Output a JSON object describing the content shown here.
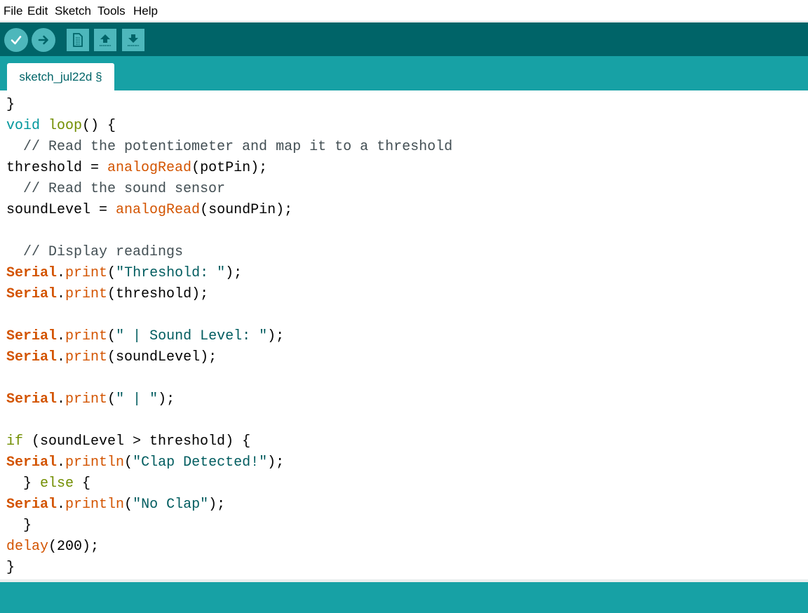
{
  "menu": [
    "File",
    "Edit",
    "Sketch",
    "Tools",
    "Help"
  ],
  "toolbar": {
    "buttons": [
      "verify-icon",
      "upload-icon",
      "new-icon",
      "open-icon",
      "save-icon"
    ]
  },
  "tab": {
    "label": "sketch_jul22d §"
  },
  "colors": {
    "default": "#000000",
    "keyword": "#00979c",
    "function": "#d35400",
    "class": "#d35400",
    "comment": "#434f54",
    "string": "#005c5f",
    "control": "#728e00",
    "toolbar": "#006468",
    "accent": "#17a1a5"
  },
  "code": [
    [
      [
        "}",
        "default"
      ]
    ],
    [
      [
        "void",
        "keyword"
      ],
      [
        " ",
        "default"
      ],
      [
        "loop",
        "control"
      ],
      [
        "() {",
        "default"
      ]
    ],
    [
      [
        "  // Read the potentiometer and map it to a threshold",
        "comment"
      ]
    ],
    [
      [
        "threshold = ",
        "default"
      ],
      [
        "analogRead",
        "function"
      ],
      [
        "(potPin);",
        "default"
      ]
    ],
    [
      [
        "  // Read the sound sensor",
        "comment"
      ]
    ],
    [
      [
        "soundLevel = ",
        "default"
      ],
      [
        "analogRead",
        "function"
      ],
      [
        "(soundPin);",
        "default"
      ]
    ],
    [],
    [
      [
        "  // Display readings",
        "comment"
      ]
    ],
    [
      [
        "Serial",
        "class"
      ],
      [
        ".",
        "default"
      ],
      [
        "print",
        "function"
      ],
      [
        "(",
        "default"
      ],
      [
        "\"Threshold: \"",
        "string"
      ],
      [
        ");",
        "default"
      ]
    ],
    [
      [
        "Serial",
        "class"
      ],
      [
        ".",
        "default"
      ],
      [
        "print",
        "function"
      ],
      [
        "(threshold);",
        "default"
      ]
    ],
    [],
    [
      [
        "Serial",
        "class"
      ],
      [
        ".",
        "default"
      ],
      [
        "print",
        "function"
      ],
      [
        "(",
        "default"
      ],
      [
        "\" | Sound Level: \"",
        "string"
      ],
      [
        ");",
        "default"
      ]
    ],
    [
      [
        "Serial",
        "class"
      ],
      [
        ".",
        "default"
      ],
      [
        "print",
        "function"
      ],
      [
        "(soundLevel);",
        "default"
      ]
    ],
    [],
    [
      [
        "Serial",
        "class"
      ],
      [
        ".",
        "default"
      ],
      [
        "print",
        "function"
      ],
      [
        "(",
        "default"
      ],
      [
        "\" | \"",
        "string"
      ],
      [
        ");",
        "default"
      ]
    ],
    [],
    [
      [
        "if",
        "control"
      ],
      [
        " (soundLevel > threshold) {",
        "default"
      ]
    ],
    [
      [
        "Serial",
        "class"
      ],
      [
        ".",
        "default"
      ],
      [
        "println",
        "function"
      ],
      [
        "(",
        "default"
      ],
      [
        "\"Clap Detected!\"",
        "string"
      ],
      [
        ");",
        "default"
      ]
    ],
    [
      [
        "  } ",
        "default"
      ],
      [
        "else",
        "control"
      ],
      [
        " {",
        "default"
      ]
    ],
    [
      [
        "Serial",
        "class"
      ],
      [
        ".",
        "default"
      ],
      [
        "println",
        "function"
      ],
      [
        "(",
        "default"
      ],
      [
        "\"No Clap\"",
        "string"
      ],
      [
        ");",
        "default"
      ]
    ],
    [
      [
        "  }",
        "default"
      ]
    ],
    [
      [
        "delay",
        "function"
      ],
      [
        "(200);",
        "default"
      ]
    ],
    [
      [
        "}",
        "default"
      ]
    ]
  ]
}
